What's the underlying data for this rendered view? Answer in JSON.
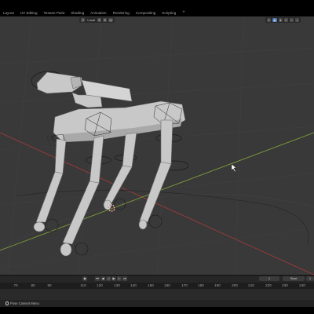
{
  "workspace_tabs": [
    "Layout",
    "UV Editing",
    "Texture Paint",
    "Shading",
    "Animation",
    "Rendering",
    "Compositing",
    "Scripting"
  ],
  "add_workspace": "+",
  "viewport_header": {
    "transform_orientation": "Local",
    "icons": [
      "transform-pivot-icon",
      "snap-icon",
      "proportional-edit-icon",
      "overlay-icon",
      "xray-icon",
      "shading-solid-icon",
      "shading-material-icon",
      "shading-rendered-icon"
    ]
  },
  "timeline": {
    "frame_labels": [
      "70",
      "80",
      "90",
      "110",
      "120",
      "130",
      "140",
      "150",
      "160",
      "170",
      "180",
      "190",
      "200",
      "210",
      "220",
      "230",
      "240"
    ],
    "current_frame": "1",
    "start_label": "Start",
    "end_label": "1",
    "keyframe_marker": "◆"
  },
  "status": {
    "hint": "Pose Context Menu"
  },
  "colors": {
    "viewport_bg": "#393939",
    "x_axis": "#a03a3a",
    "y_axis": "#7c9a3a",
    "accent": "#4772b3",
    "model": "#c9c9c9"
  }
}
